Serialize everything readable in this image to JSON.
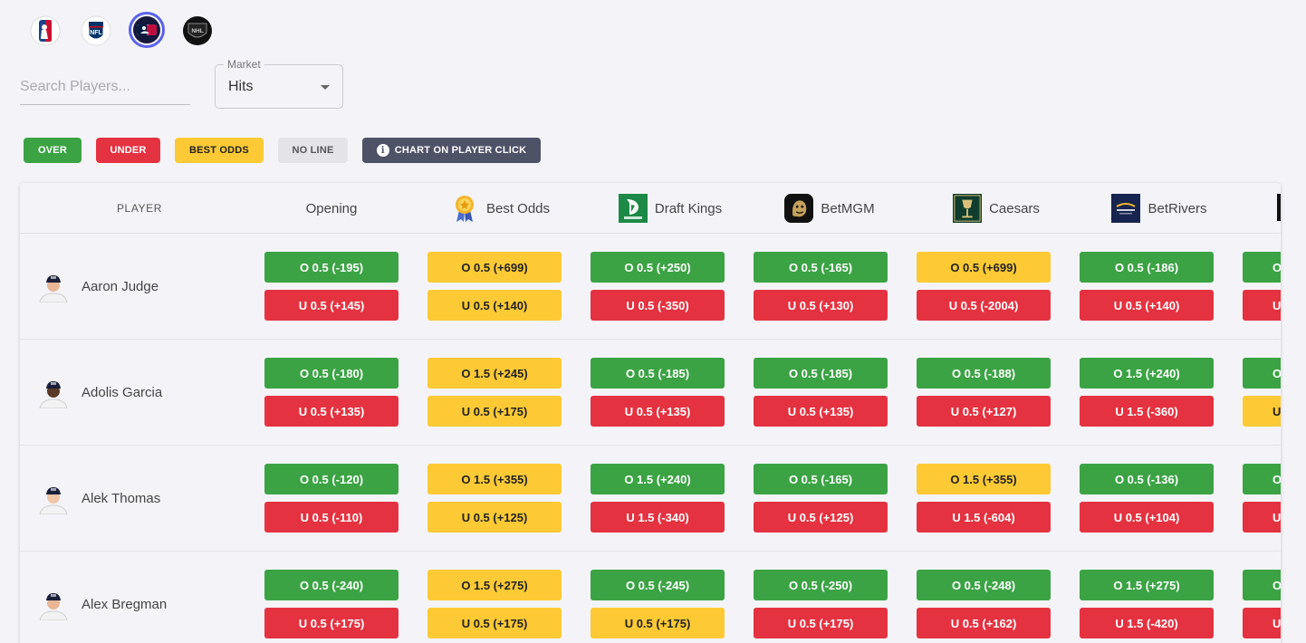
{
  "leagues": [
    {
      "name": "NBA",
      "icon": "nba-logo-icon",
      "active": false
    },
    {
      "name": "NFL",
      "icon": "nfl-logo-icon",
      "active": false
    },
    {
      "name": "MLB",
      "icon": "mlb-logo-icon",
      "active": true
    },
    {
      "name": "NHL",
      "icon": "nhl-logo-icon",
      "active": false
    }
  ],
  "search": {
    "placeholder": "Search Players..."
  },
  "market": {
    "label": "Market",
    "value": "Hits"
  },
  "legend": {
    "over": "OVER",
    "under": "UNDER",
    "best": "BEST ODDS",
    "noline": "NO LINE",
    "chart": "CHART ON PLAYER CLICK"
  },
  "colors": {
    "over": "#3ba344",
    "under": "#e43240",
    "best": "#fdca35",
    "noline": "#e3e3e8",
    "accent": "#5b62e8"
  },
  "table": {
    "player_header": "PLAYER",
    "columns": [
      "Opening",
      "Best Odds",
      "Draft Kings",
      "BetMGM",
      "Caesars",
      "BetRivers"
    ],
    "rows": [
      {
        "player": "Aaron Judge",
        "cells": [
          {
            "over": "O 0.5 (-195)",
            "under": "U 0.5 (+145)",
            "oc": "green",
            "uc": "red"
          },
          {
            "over": "O 0.5 (+699)",
            "under": "U 0.5 (+140)",
            "oc": "yellow",
            "uc": "yellow"
          },
          {
            "over": "O 0.5 (+250)",
            "under": "U 0.5 (-350)",
            "oc": "green",
            "uc": "red"
          },
          {
            "over": "O 0.5 (-165)",
            "under": "U 0.5 (+130)",
            "oc": "green",
            "uc": "red"
          },
          {
            "over": "O 0.5 (+699)",
            "under": "U 0.5 (-2004)",
            "oc": "yellow",
            "uc": "red"
          },
          {
            "over": "O 0.5 (-186)",
            "under": "U 0.5 (+140)",
            "oc": "green",
            "uc": "red"
          }
        ]
      },
      {
        "player": "Adolis Garcia",
        "cells": [
          {
            "over": "O 0.5 (-180)",
            "under": "U 0.5 (+135)",
            "oc": "green",
            "uc": "red"
          },
          {
            "over": "O 1.5 (+245)",
            "under": "U 0.5 (+175)",
            "oc": "yellow",
            "uc": "yellow"
          },
          {
            "over": "O 0.5 (-185)",
            "under": "U 0.5 (+135)",
            "oc": "green",
            "uc": "red"
          },
          {
            "over": "O 0.5 (-185)",
            "under": "U 0.5 (+135)",
            "oc": "green",
            "uc": "red"
          },
          {
            "over": "O 0.5 (-188)",
            "under": "U 0.5 (+127)",
            "oc": "green",
            "uc": "red"
          },
          {
            "over": "O 1.5 (+240)",
            "under": "U 1.5 (-360)",
            "oc": "green",
            "uc": "red"
          }
        ]
      },
      {
        "player": "Alek Thomas",
        "cells": [
          {
            "over": "O 0.5 (-120)",
            "under": "U 0.5 (-110)",
            "oc": "green",
            "uc": "red"
          },
          {
            "over": "O 1.5 (+355)",
            "under": "U 0.5 (+125)",
            "oc": "yellow",
            "uc": "yellow"
          },
          {
            "over": "O 1.5 (+240)",
            "under": "U 1.5 (-340)",
            "oc": "green",
            "uc": "red"
          },
          {
            "over": "O 0.5 (-165)",
            "under": "U 0.5 (+125)",
            "oc": "green",
            "uc": "red"
          },
          {
            "over": "O 1.5 (+355)",
            "under": "U 1.5 (-604)",
            "oc": "yellow",
            "uc": "red"
          },
          {
            "over": "O 0.5 (-136)",
            "under": "U 0.5 (+104)",
            "oc": "green",
            "uc": "red"
          }
        ]
      },
      {
        "player": "Alex Bregman",
        "cells": [
          {
            "over": "O 0.5 (-240)",
            "under": "U 0.5 (+175)",
            "oc": "green",
            "uc": "red"
          },
          {
            "over": "O 1.5 (+275)",
            "under": "U 0.5 (+175)",
            "oc": "yellow",
            "uc": "yellow"
          },
          {
            "over": "O 0.5 (-245)",
            "under": "U 0.5 (+175)",
            "oc": "green",
            "uc": "yellow"
          },
          {
            "over": "O 0.5 (-250)",
            "under": "U 0.5 (+175)",
            "oc": "green",
            "uc": "red"
          },
          {
            "over": "O 0.5 (-248)",
            "under": "U 0.5 (+162)",
            "oc": "green",
            "uc": "red"
          },
          {
            "over": "O 1.5 (+275)",
            "under": "U 1.5 (-420)",
            "oc": "green",
            "uc": "red"
          }
        ]
      }
    ],
    "partial_column": {
      "over_label": "O",
      "under_label": "U",
      "colors": [
        [
          "green",
          "red"
        ],
        [
          "green",
          "yellow"
        ],
        [
          "green",
          "red"
        ],
        [
          "green",
          "red"
        ]
      ]
    }
  }
}
